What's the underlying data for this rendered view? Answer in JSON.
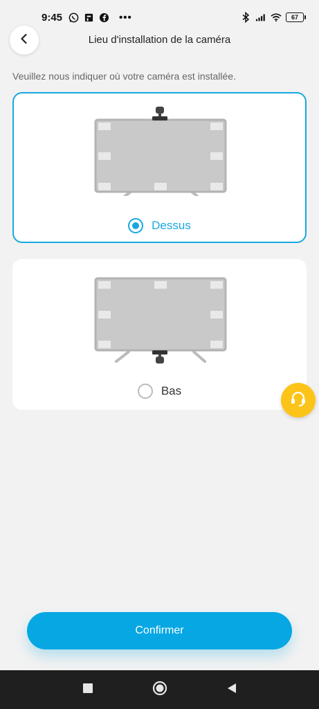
{
  "status_bar": {
    "time": "9:45",
    "battery": "67",
    "icons_left": [
      "whatsapp-icon",
      "notification-icon",
      "facebook-icon"
    ],
    "more": "•••",
    "icons_right": [
      "bluetooth-icon",
      "signal-icon",
      "wifi-icon",
      "battery-icon"
    ]
  },
  "header": {
    "title": "Lieu d'installation de la caméra"
  },
  "instruction": "Veuillez nous indiquer où votre caméra est installée.",
  "options": [
    {
      "label": "Dessus",
      "selected": true
    },
    {
      "label": "Bas",
      "selected": false
    }
  ],
  "confirm_label": "Confirmer",
  "colors": {
    "accent": "#17a8e0",
    "confirm": "#06a7e2",
    "support": "#fcc419",
    "background": "#f2f2f2"
  }
}
